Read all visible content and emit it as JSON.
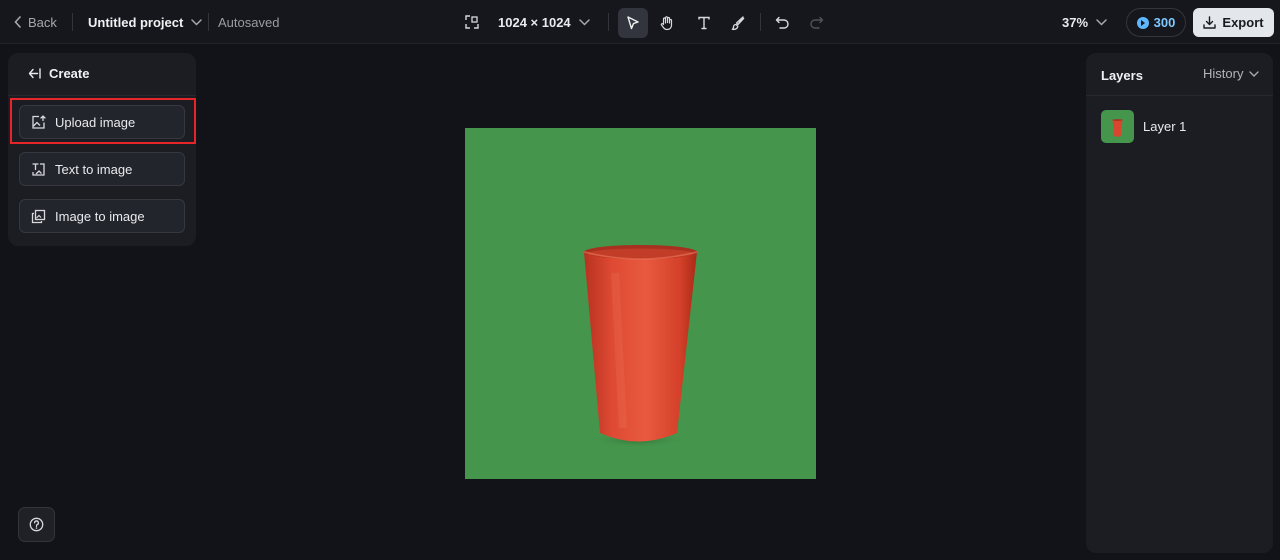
{
  "topbar": {
    "back_label": "Back",
    "project_name": "Untitled project",
    "save_status": "Autosaved",
    "canvas_size": "1024 × 1024",
    "zoom": "37%",
    "credits": "300",
    "export_label": "Export"
  },
  "tools": [
    {
      "name": "select",
      "icon": "cursor-icon",
      "active": true
    },
    {
      "name": "pan",
      "icon": "hand-icon",
      "active": false
    },
    {
      "name": "text",
      "icon": "text-icon",
      "active": false
    },
    {
      "name": "brush",
      "icon": "brush-icon",
      "active": false
    },
    {
      "name": "undo",
      "icon": "undo-icon",
      "active": false
    },
    {
      "name": "redo",
      "icon": "redo-icon",
      "active": false
    }
  ],
  "left_panel": {
    "title": "Create",
    "buttons": [
      {
        "label": "Upload image",
        "icon": "upload-image-icon"
      },
      {
        "label": "Text to image",
        "icon": "text-to-image-icon"
      },
      {
        "label": "Image to image",
        "icon": "image-to-image-icon"
      }
    ]
  },
  "right_panel": {
    "title": "Layers",
    "history_label": "History",
    "layers": [
      {
        "name": "Layer 1"
      }
    ]
  },
  "colors": {
    "background": "#121318",
    "panel": "#1b1d23",
    "canvas_green": "#45954c",
    "cup_red": "#de4a33",
    "highlight": "#e5252a",
    "credits_blue": "#5fb7ff"
  }
}
